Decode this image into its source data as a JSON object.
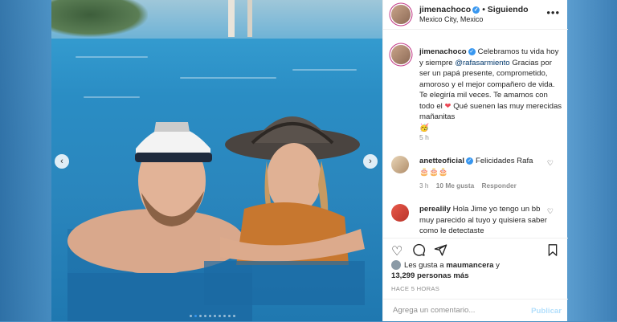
{
  "post": {
    "username": "jimenachoco",
    "follow_state": "Siguiendo",
    "location": "Mexico City, Mexico",
    "caption_prefix": "Celebramos tu vida hoy y siempre ",
    "caption_mention": "@rafasarmiento",
    "caption_suffix": " Gracias por ser un papá presente, comprometido, amoroso y el mejor compañero de vida. Te elegiría mil veces. Te amamos con todo el ",
    "caption_tail": " Qué suenen las muy merecidas mañanitas",
    "caption_time": "5 h"
  },
  "comments": [
    {
      "username": "anetteoficial",
      "text": "Felicidades Rafa",
      "emoji": "🎂🎂🎂",
      "time": "3 h",
      "likes": "10 Me gusta",
      "reply": "Responder"
    },
    {
      "username": "perealily",
      "text": "Hola Jime yo tengo un bb muy parecido al tuyo y quisiera saber como le detectaste"
    }
  ],
  "likes_text_prefix": "Les gusta a ",
  "likes_user": "maumancera",
  "likes_text_mid": " y",
  "likes_count": "13,299 personas más",
  "posted_ago": "HACE 5 HORAS",
  "comment_box": {
    "placeholder": "Agrega un comentario...",
    "publish": "Publicar"
  },
  "icons": {
    "verified": "verified-badge-icon",
    "more": "more-options-icon",
    "heart": "heart-icon",
    "comment": "comment-icon",
    "share": "share-icon",
    "save": "bookmark-icon"
  },
  "colors": {
    "link": "#00376b",
    "verified": "#3897f0",
    "muted": "#8e8e8e",
    "publish": "#b2dffc"
  }
}
